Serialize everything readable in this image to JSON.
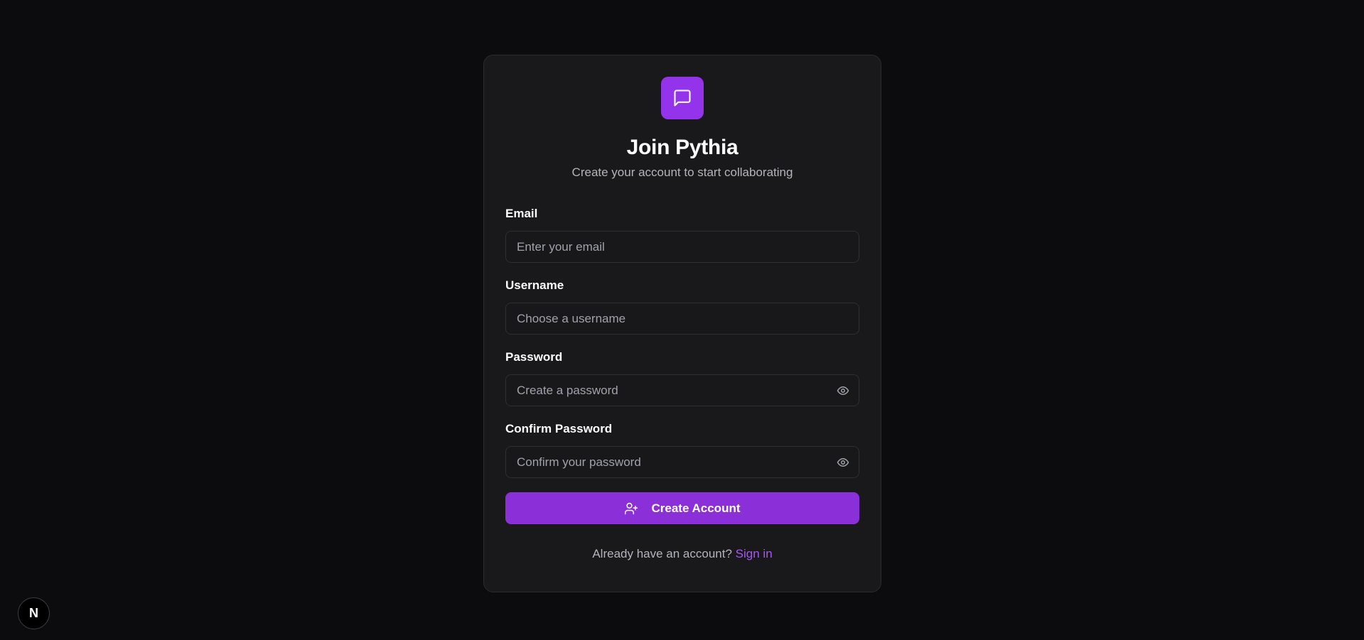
{
  "brand": {
    "logo_icon": "message-square-icon",
    "accent_color": "#9333ea"
  },
  "header": {
    "title": "Join Pythia",
    "subtitle": "Create your account to start collaborating"
  },
  "form": {
    "email": {
      "label": "Email",
      "placeholder": "Enter your email",
      "value": ""
    },
    "username": {
      "label": "Username",
      "placeholder": "Choose a username",
      "value": ""
    },
    "password": {
      "label": "Password",
      "placeholder": "Create a password",
      "value": "",
      "toggle_icon": "eye-icon"
    },
    "confirm_password": {
      "label": "Confirm Password",
      "placeholder": "Confirm your password",
      "value": "",
      "toggle_icon": "eye-icon"
    },
    "submit": {
      "label": "Create Account",
      "icon": "user-plus-icon",
      "color": "#8b2fd9"
    }
  },
  "footer": {
    "prompt": "Already have an account?",
    "link_label": "Sign in",
    "link_color": "#a855f7"
  },
  "dev_badge": {
    "letter": "N",
    "icon": "nextjs-icon"
  }
}
